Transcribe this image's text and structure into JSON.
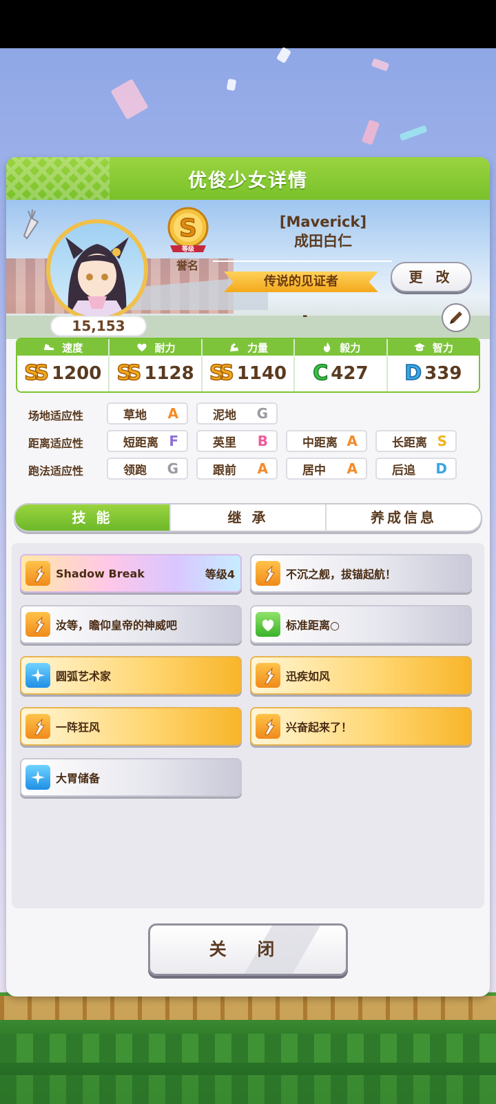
{
  "colors": {
    "header_green": "#7dc43a",
    "accent_gold": "#f0a81d",
    "panel_bg": "#f6f6f8"
  },
  "dialog": {
    "title": "优俊少女详情"
  },
  "profile": {
    "trainer_name": "[Maverick]",
    "horse_name": "成田白仁",
    "fans": "15,153",
    "rank_grade": "S",
    "rank_sub": "等级",
    "rank_label": "誉名",
    "title": "传说的见证者",
    "change_label": "更 改",
    "comment": "-"
  },
  "stats": [
    {
      "name": "速度",
      "icon": "shoe-icon",
      "grade": "SS",
      "value": "1200",
      "grade_class": "ss"
    },
    {
      "name": "耐力",
      "icon": "heart-icon",
      "grade": "SS",
      "value": "1128",
      "grade_class": "ss"
    },
    {
      "name": "力量",
      "icon": "arm-icon",
      "grade": "SS",
      "value": "1140",
      "grade_class": "ss"
    },
    {
      "name": "毅力",
      "icon": "flame-icon",
      "grade": "C",
      "value": "427",
      "grade_class": "c"
    },
    {
      "name": "智力",
      "icon": "graduation-cap-icon",
      "grade": "D",
      "value": "339",
      "grade_class": "d"
    }
  ],
  "aptitude": {
    "surface": {
      "label": "场地适应性",
      "items": [
        {
          "name": "草地",
          "grade": "A"
        },
        {
          "name": "泥地",
          "grade": "G"
        }
      ]
    },
    "distance": {
      "label": "距离适应性",
      "items": [
        {
          "name": "短距离",
          "grade": "F"
        },
        {
          "name": "英里",
          "grade": "B"
        },
        {
          "name": "中距离",
          "grade": "A"
        },
        {
          "name": "长距离",
          "grade": "S"
        }
      ]
    },
    "style": {
      "label": "跑法适应性",
      "items": [
        {
          "name": "领跑",
          "grade": "G"
        },
        {
          "name": "跟前",
          "grade": "A"
        },
        {
          "name": "居中",
          "grade": "A"
        },
        {
          "name": "后追",
          "grade": "D"
        }
      ]
    }
  },
  "tabs": [
    {
      "label": "技 能",
      "active": true
    },
    {
      "label": "继 承"
    },
    {
      "label": "养成信息"
    }
  ],
  "skills": [
    {
      "name": "Shadow Break",
      "level": "等级4",
      "style": "rainbow",
      "icon": "speed"
    },
    {
      "name": "不沉之舰，拔锚起航！",
      "style": "white",
      "icon": "speed"
    },
    {
      "name": "汝等，瞻仰皇帝的神威吧",
      "style": "white",
      "icon": "speed"
    },
    {
      "name": "标准距离○",
      "style": "white",
      "icon": "heal"
    },
    {
      "name": "圆弧艺术家",
      "style": "gold",
      "icon": "blue"
    },
    {
      "name": "迅疾如风",
      "style": "gold",
      "icon": "speed"
    },
    {
      "name": "一阵狂风",
      "style": "gold",
      "icon": "speed"
    },
    {
      "name": "兴奋起来了！",
      "style": "gold",
      "icon": "speed"
    },
    {
      "name": "大胃储备",
      "style": "white",
      "icon": "blue"
    }
  ],
  "close_label": "关 闭"
}
